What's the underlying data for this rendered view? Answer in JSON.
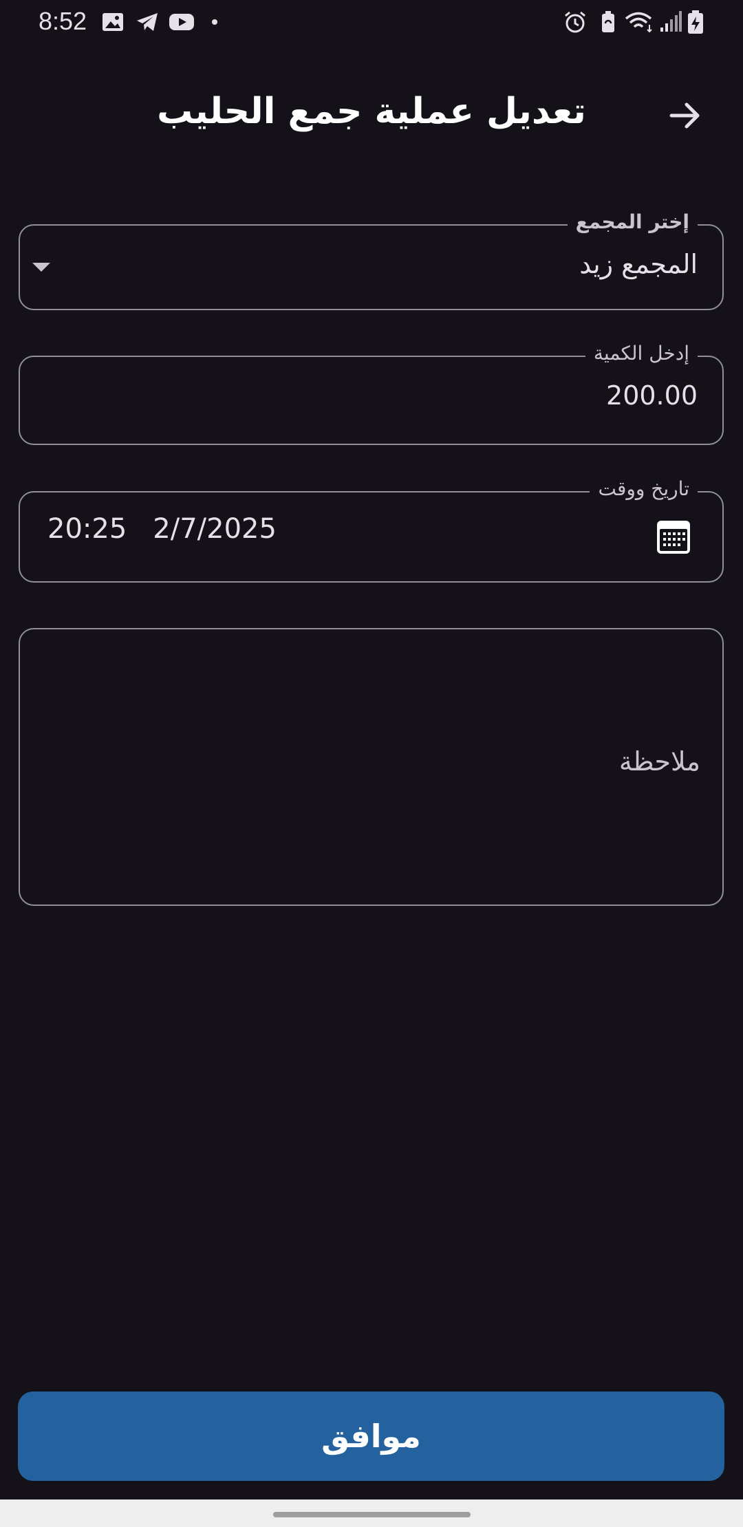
{
  "status_bar": {
    "time": "8:52",
    "left_icons": [
      "gallery-icon",
      "telegram-icon",
      "youtube-icon",
      "notification-dot-icon"
    ],
    "right_icons": [
      "alarm-icon",
      "battery-saver-icon",
      "wifi-icon",
      "signal-icon",
      "battery-charging-icon"
    ]
  },
  "header": {
    "title": "تعديل عملية جمع الحليب",
    "back_icon": "arrow-right-icon"
  },
  "form": {
    "collector": {
      "label": "إختر المجمع",
      "value": "المجمع زيد"
    },
    "quantity": {
      "label": "إدخل الكمية",
      "value": "200.00"
    },
    "datetime": {
      "label": "تاريخ ووقت",
      "date": "2/7/2025",
      "time": "20:25",
      "icon": "calendar-icon"
    },
    "notes": {
      "placeholder": "ملاحظة"
    }
  },
  "actions": {
    "ok_label": "موافق"
  },
  "colors": {
    "background": "#141218",
    "outline": "#938F99",
    "primary_button": "#24619F",
    "text": "#E6E0E9"
  }
}
